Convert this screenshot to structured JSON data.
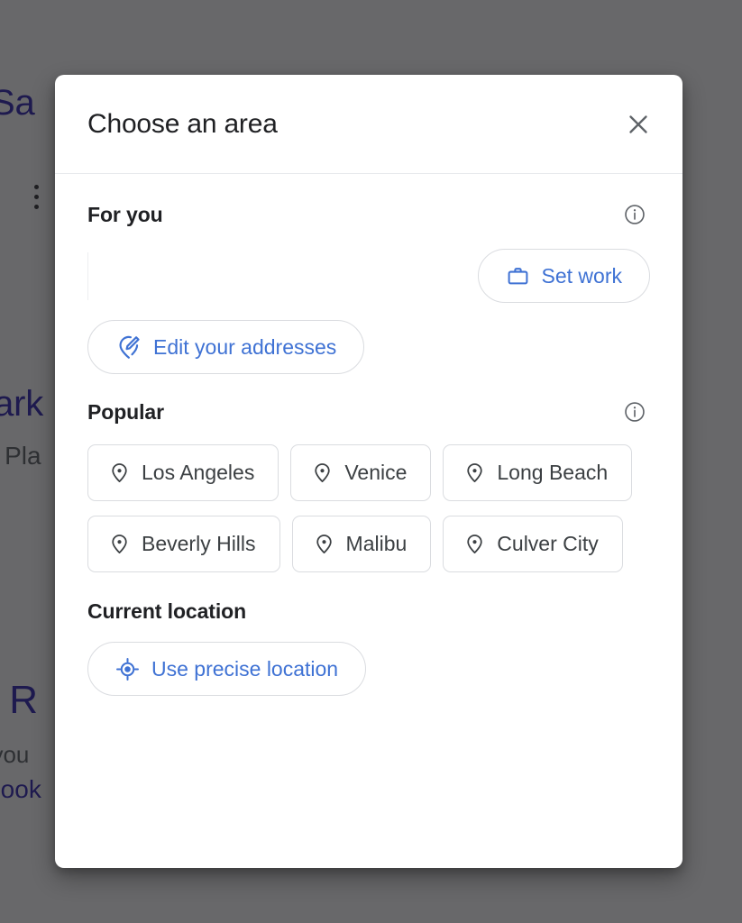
{
  "background": {
    "fragment_heading_1": "r Sa",
    "kebab_menu_icon": "more-vertical-icon",
    "fragment_heading_2": "Mark",
    "fragment_subtext_2": "'s Pla",
    "fragment_heading_3": "n R",
    "fragment_subtext_3": "t you",
    "fragment_link_3": "Book",
    "scrim_color": "#202124"
  },
  "dialog": {
    "title": "Choose an area",
    "close_icon": "close-icon",
    "sections": {
      "for_you": {
        "title": "For you",
        "info_icon": "info-icon",
        "chips": [
          {
            "label": "Set work",
            "icon": "briefcase-icon",
            "color": "#3f72d4"
          },
          {
            "label": "Edit your addresses",
            "icon": "edit-location-icon",
            "color": "#3f72d4"
          }
        ]
      },
      "popular": {
        "title": "Popular",
        "info_icon": "info-icon",
        "chips": [
          {
            "label": "Los Angeles",
            "icon": "place-pin-icon"
          },
          {
            "label": "Venice",
            "icon": "place-pin-icon"
          },
          {
            "label": "Long Beach",
            "icon": "place-pin-icon"
          },
          {
            "label": "Beverly Hills",
            "icon": "place-pin-icon"
          },
          {
            "label": "Malibu",
            "icon": "place-pin-icon"
          },
          {
            "label": "Culver City",
            "icon": "place-pin-icon"
          }
        ]
      },
      "current_location": {
        "title": "Current location",
        "chips": [
          {
            "label": "Use precise location",
            "icon": "gps-target-icon",
            "color": "#3f72d4"
          }
        ]
      }
    }
  },
  "colors": {
    "accent_blue": "#3f72d4",
    "text_primary": "#202124",
    "text_secondary": "#3c4043",
    "border": "#dadce0",
    "link_blue": "#1a0dab"
  }
}
